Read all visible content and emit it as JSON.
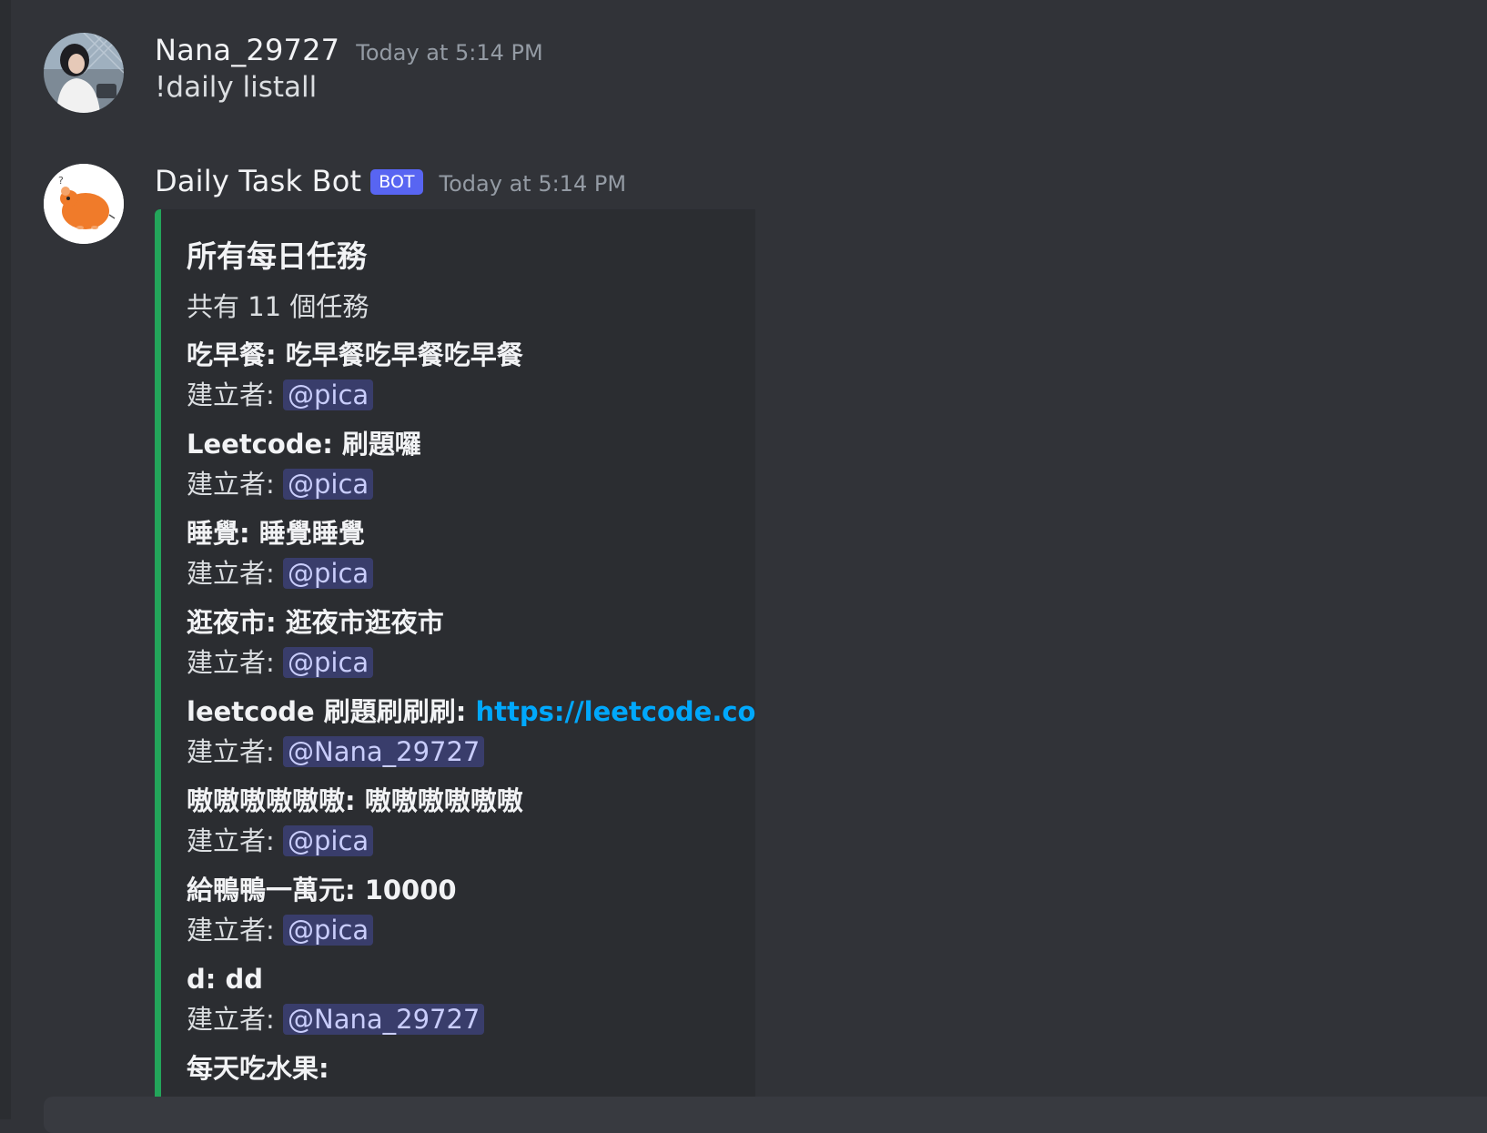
{
  "messages": [
    {
      "username": "Nana_29727",
      "timestamp": "Today at 5:14 PM",
      "content": "!daily listall"
    },
    {
      "username": "Daily Task Bot",
      "bot_tag": "BOT",
      "timestamp": "Today at 5:14 PM",
      "embed": {
        "accent_color": "#23a55a",
        "title": "所有每日任務",
        "description": "共有 11 個任務",
        "creator_label": "建立者:",
        "fields": [
          {
            "name": "吃早餐: 吃早餐吃早餐吃早餐",
            "creator": "@pica"
          },
          {
            "name": "Leetcode: 刷題囉",
            "creator": "@pica"
          },
          {
            "name": "睡覺: 睡覺睡覺",
            "creator": "@pica"
          },
          {
            "name": "逛夜市: 逛夜市逛夜市",
            "creator": "@pica"
          },
          {
            "name": "leetcode 刷題刷刷刷:",
            "link": "https://leetcode.com/",
            "creator": "@Nana_29727"
          },
          {
            "name": "嗷嗷嗷嗷嗷嗷: 嗷嗷嗷嗷嗷嗷",
            "creator": "@pica"
          },
          {
            "name": "給鴨鴨一萬元: 10000",
            "creator": "@pica"
          },
          {
            "name": "d: dd",
            "creator": "@Nana_29727"
          },
          {
            "name": "每天吃水果:"
          }
        ]
      }
    }
  ],
  "colors": {
    "background": "#313338",
    "embed_background": "#2b2d31",
    "bot_tag": "#5865f2",
    "link": "#00a8fc",
    "mention_text": "#c9cdfb"
  }
}
